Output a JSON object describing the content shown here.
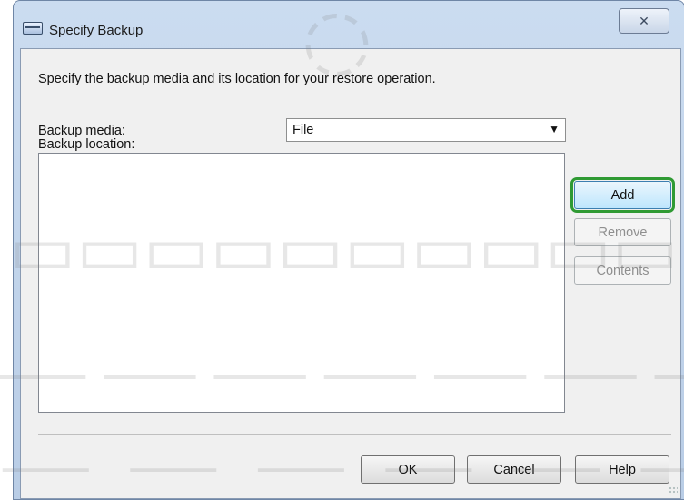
{
  "window": {
    "title": "Specify Backup",
    "close_label": "✕"
  },
  "dialog": {
    "instruction": "Specify the backup media and its location for your restore operation.",
    "backup_media_label": "Backup media:",
    "backup_media_value": "File",
    "backup_location_label": "Backup location:",
    "backup_location_items": []
  },
  "buttons": {
    "add": "Add",
    "remove": "Remove",
    "contents": "Contents",
    "ok": "OK",
    "cancel": "Cancel",
    "help": "Help"
  },
  "icons": {
    "title": "window-icon",
    "dropdown": "chevron-down-icon",
    "grip": "resize-grip-icon"
  },
  "colors": {
    "focus_outline": "#2f9a33",
    "client_bg": "#f0f0f0",
    "titlebar": "#c4d7ee"
  }
}
